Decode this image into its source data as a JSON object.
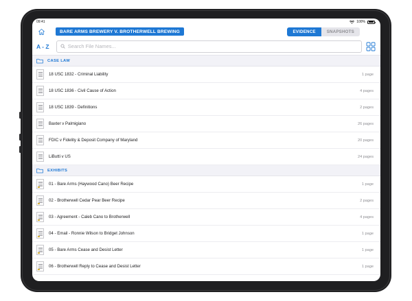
{
  "status": {
    "time": "09:41",
    "battery": "100%",
    "battery_level": 1.0
  },
  "header": {
    "case_title": "BARE ARMS BREWERY V. BROTHERWELL BREWING",
    "tabs": [
      {
        "label": "EVIDENCE",
        "active": true
      },
      {
        "label": "SNAPSHOTS",
        "active": false
      }
    ]
  },
  "search": {
    "sort_label": "A - Z",
    "placeholder": "Search File Names..."
  },
  "icons": {
    "home": "home-icon",
    "search": "search-icon",
    "folder": "folder-icon",
    "grid": "grid-view-icon",
    "document": "document-icon"
  },
  "colors": {
    "accent": "#1e78d4",
    "section_bg": "#f2f2f7",
    "muted_text": "#8e8e93",
    "tab_tag": "#d8b23a"
  },
  "sections": [
    {
      "title": "CASE LAW",
      "items": [
        {
          "name": "18 USC 1832 - Criminal Liability",
          "pages": "1 page"
        },
        {
          "name": "18 USC 1836 - Civil Cause of Action",
          "pages": "4 pages"
        },
        {
          "name": "18 USC 1839 - Definitions",
          "pages": "2 pages"
        },
        {
          "name": "Baxter v Palmigiano",
          "pages": "26 pages"
        },
        {
          "name": "FDIC v Fidelity & Deposit Company of Maryland",
          "pages": "20 pages"
        },
        {
          "name": "LiButti v US",
          "pages": "24 pages"
        }
      ]
    },
    {
      "title": "EXHIBITS",
      "items": [
        {
          "name": "01 - Bare Arms (Haywood Cano) Beer Recipe",
          "pages": "1 page"
        },
        {
          "name": "02 - Brotherwell Cedar Pear Beer Recipe",
          "pages": "2 pages"
        },
        {
          "name": "03 - Agreement - Caleb Cano to Brotherwell",
          "pages": "4 pages"
        },
        {
          "name": "04 - Email - Ronnie Wilson to Bridget Johnson",
          "pages": "1 page"
        },
        {
          "name": "05 - Bare Arms Cease and Desist Letter",
          "pages": "1 page"
        },
        {
          "name": "06 - Brotherwell Reply to Cease and Desist Letter",
          "pages": "1 page"
        }
      ]
    }
  ]
}
